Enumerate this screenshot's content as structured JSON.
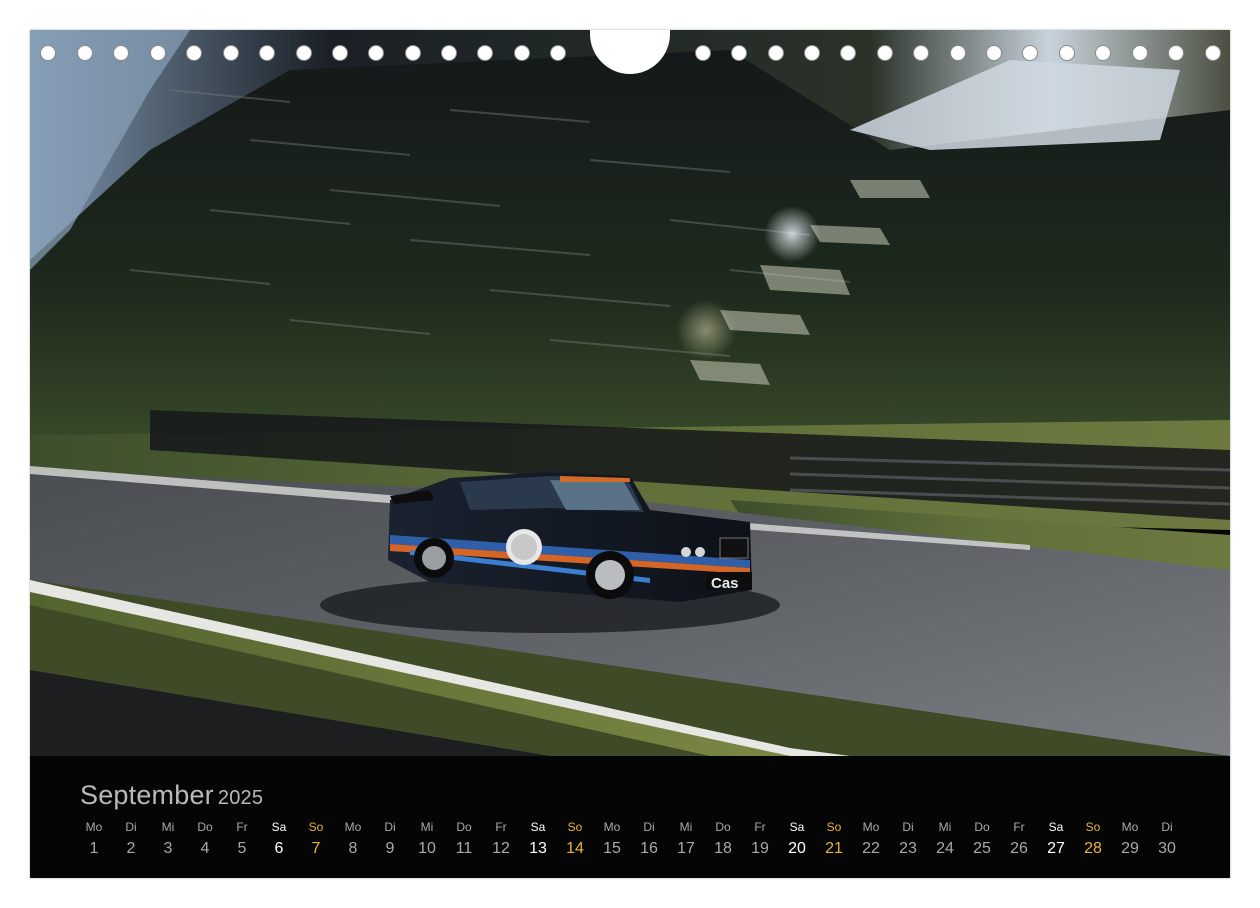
{
  "photo": {
    "subject_icon": "race-car-photo",
    "car_lettering": "Cas"
  },
  "calendar": {
    "month": "September",
    "year": "2025",
    "days": [
      {
        "dow": "Mo",
        "num": "1",
        "kind": "weekday"
      },
      {
        "dow": "Di",
        "num": "2",
        "kind": "weekday"
      },
      {
        "dow": "Mi",
        "num": "3",
        "kind": "weekday"
      },
      {
        "dow": "Do",
        "num": "4",
        "kind": "weekday"
      },
      {
        "dow": "Fr",
        "num": "5",
        "kind": "weekday"
      },
      {
        "dow": "Sa",
        "num": "6",
        "kind": "sat"
      },
      {
        "dow": "So",
        "num": "7",
        "kind": "sun"
      },
      {
        "dow": "Mo",
        "num": "8",
        "kind": "weekday"
      },
      {
        "dow": "Di",
        "num": "9",
        "kind": "weekday"
      },
      {
        "dow": "Mi",
        "num": "10",
        "kind": "weekday"
      },
      {
        "dow": "Do",
        "num": "11",
        "kind": "weekday"
      },
      {
        "dow": "Fr",
        "num": "12",
        "kind": "weekday"
      },
      {
        "dow": "Sa",
        "num": "13",
        "kind": "sat"
      },
      {
        "dow": "So",
        "num": "14",
        "kind": "sun"
      },
      {
        "dow": "Mo",
        "num": "15",
        "kind": "weekday"
      },
      {
        "dow": "Di",
        "num": "16",
        "kind": "weekday"
      },
      {
        "dow": "Mi",
        "num": "17",
        "kind": "weekday"
      },
      {
        "dow": "Do",
        "num": "18",
        "kind": "weekday"
      },
      {
        "dow": "Fr",
        "num": "19",
        "kind": "weekday"
      },
      {
        "dow": "Sa",
        "num": "20",
        "kind": "sat"
      },
      {
        "dow": "So",
        "num": "21",
        "kind": "sun"
      },
      {
        "dow": "Mo",
        "num": "22",
        "kind": "weekday"
      },
      {
        "dow": "Di",
        "num": "23",
        "kind": "weekday"
      },
      {
        "dow": "Mi",
        "num": "24",
        "kind": "weekday"
      },
      {
        "dow": "Do",
        "num": "25",
        "kind": "weekday"
      },
      {
        "dow": "Fr",
        "num": "26",
        "kind": "weekday"
      },
      {
        "dow": "Sa",
        "num": "27",
        "kind": "sat"
      },
      {
        "dow": "So",
        "num": "28",
        "kind": "sun"
      },
      {
        "dow": "Mo",
        "num": "29",
        "kind": "weekday"
      },
      {
        "dow": "Di",
        "num": "30",
        "kind": "weekday"
      }
    ]
  },
  "colors": {
    "weekday": "#a9a9a9",
    "saturday": "#ffffff",
    "sunday": "#e9b43a",
    "background": "#050505"
  }
}
